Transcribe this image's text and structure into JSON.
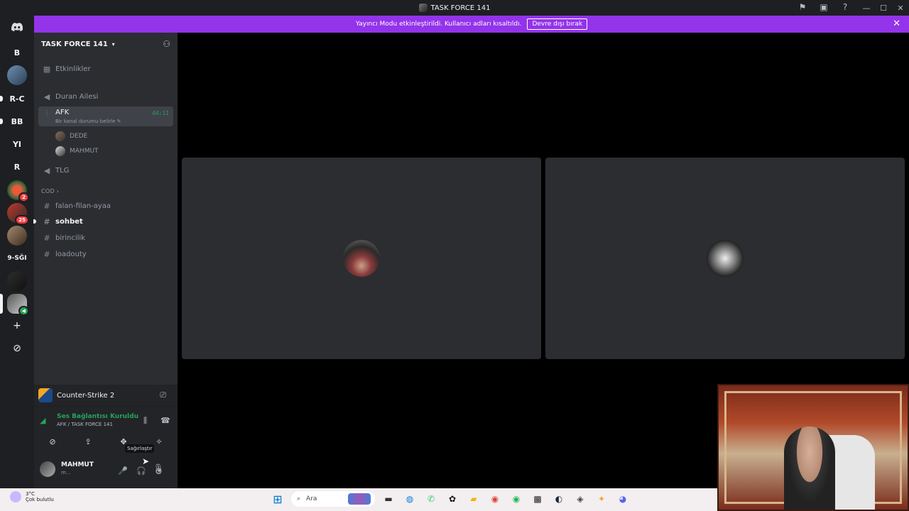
{
  "window": {
    "title": "TASK FORCE 141",
    "controls": [
      "—",
      "☐",
      "✕"
    ],
    "toolbar_icons": [
      "flag-icon",
      "inbox-icon",
      "help-icon"
    ]
  },
  "rail": {
    "servers": [
      {
        "label": "B"
      },
      {
        "label": "R-C"
      },
      {
        "label": "BB"
      },
      {
        "label": "YI"
      },
      {
        "label": "R"
      },
      {
        "label": "9-SĞI"
      }
    ],
    "badges": [
      "2",
      "25"
    ],
    "add_icon": "+",
    "explore_icon": "⊘"
  },
  "banner": {
    "message": "Yayıncı Modu etkinleştirildi. Kullanıcı adları kısaltıldı.",
    "button": "Devre dışı bırak",
    "close": "✕"
  },
  "sidebar": {
    "guild_name": "TASK FORCE 141",
    "events": "Etkinlikler",
    "channels": {
      "duran": "Duran Ailesi",
      "afk": "AFK",
      "afk_timer": "44:11",
      "afk_status": "Bir kanal durumu belirle",
      "tlg": "TLG"
    },
    "voice_users": [
      "DEDE",
      "MAHMUT"
    ],
    "category": "COD",
    "text_channels": [
      "falan-filan-ayaa",
      "sohbet",
      "birincilik",
      "loadouty"
    ]
  },
  "panel": {
    "activity": "Counter-Strike 2",
    "voice_connected": "Ses Bağlantısı Kuruldu",
    "voice_channel": "AFK / TASK FORCE 141",
    "tooltip": "Sağırlaştır",
    "user_name": "MAHMUT",
    "user_status": "m..."
  },
  "taskbar": {
    "temperature": "3°C",
    "weather": "Çok bulutlu",
    "search_placeholder": "Ara"
  },
  "colors": {
    "banner": "#9333ea",
    "accent_green": "#23a55a",
    "sidebar_bg": "#2b2d31",
    "rail_bg": "#1e1f22"
  }
}
